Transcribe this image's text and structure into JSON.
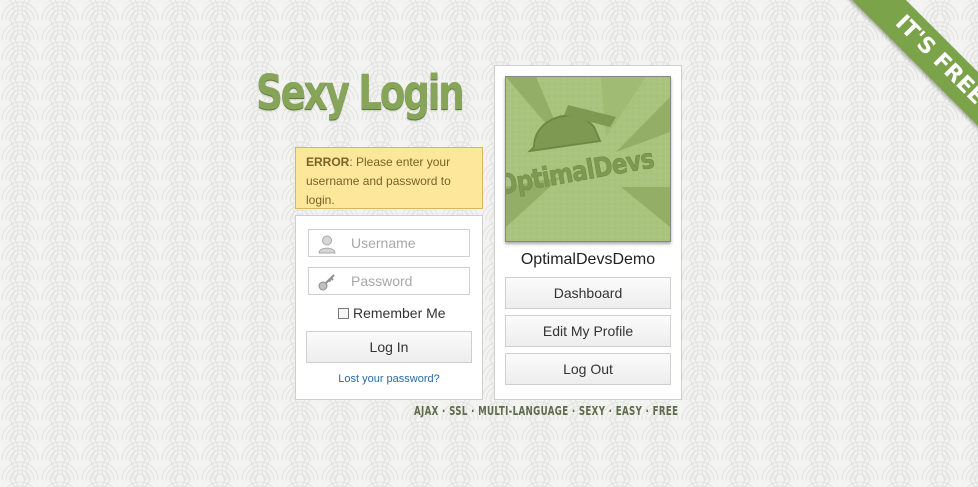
{
  "logo": {
    "text": "Sexy Login"
  },
  "error": {
    "label": "ERROR",
    "message": ": Please enter your username and password to login."
  },
  "login": {
    "username_placeholder": "Username",
    "password_placeholder": "Password",
    "remember_label": "Remember Me",
    "login_button": "Log In",
    "lost_password_link": "Lost your password?",
    "icons": {
      "username": "user-icon",
      "password": "key-icon"
    }
  },
  "profile": {
    "avatar_text": "OptimalDevs",
    "name": "OptimalDevsDemo",
    "buttons": [
      "Dashboard",
      "Edit My Profile",
      "Log Out"
    ]
  },
  "tagline": "AJAX · SSL · MULTI-LANGUAGE · SEXY · EASY · FREE",
  "ribbon": "IT'S FREE!",
  "colors": {
    "accent_green": "#7ba34a",
    "logo_green": "#86a559",
    "error_bg": "#fde79a",
    "error_border": "#d7b75e",
    "link_blue": "#2b6aa6"
  }
}
